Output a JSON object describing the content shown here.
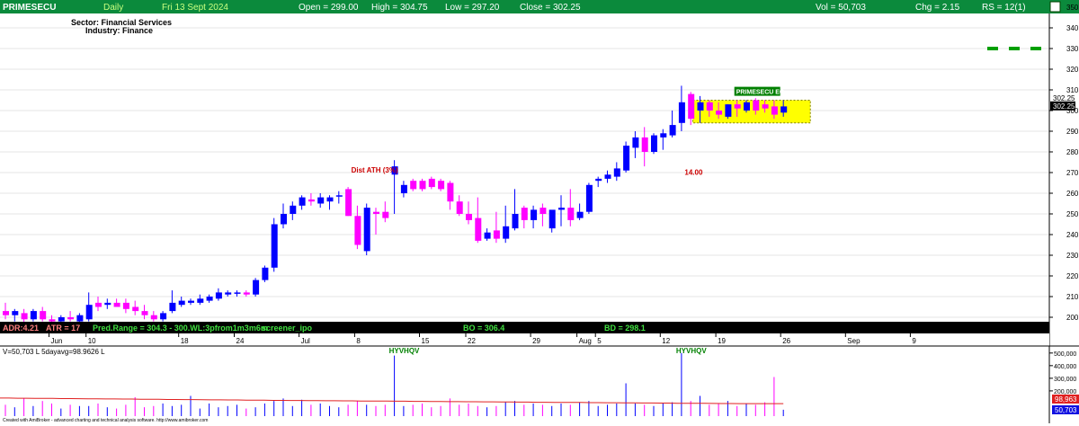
{
  "header": {
    "symbol": "PRIMESECU",
    "interval": "Daily",
    "date": "Fri 13 Sept 2024",
    "open": "Open = 299.00",
    "high": "High = 304.75",
    "low": "Low = 297.20",
    "close": "Close = 302.25",
    "volume": "Vol = 50,703",
    "change": "Chg = 2.15",
    "rs": "RS = 12(1)"
  },
  "info": {
    "sector": "Sector: Financial Services",
    "industry": "Industry: Finance"
  },
  "status_bar": {
    "adr": "ADR:4.21",
    "atr": "ATR = 17",
    "pred_range": "Pred.Range = 304.3 - 300.WL:3pfrom1m3m6m",
    "screener": "screener_ipo",
    "bo": "BO = 306.4",
    "bd": "BD = 298.1"
  },
  "volume_panel": {
    "label": "V=50,703 L 5dayavg=98.9626 L",
    "avg_value_label": "98,963",
    "last_value_label": "50,703",
    "y_ticks": [
      "500,000",
      "400,000",
      "300,000",
      "200,000"
    ],
    "ymax": 520000,
    "avg_line": [
      143000,
      143000,
      142000,
      142000,
      141000,
      140000,
      140000,
      139000,
      139000,
      138000,
      137000,
      137000,
      136000,
      136000,
      135000,
      135000,
      134000,
      134000,
      133000,
      132000,
      132000,
      131000,
      131000,
      130000,
      129000,
      129000,
      128000,
      128000,
      127000,
      126000,
      126000,
      125000,
      125000,
      124000,
      124000,
      123000,
      123000,
      122000,
      122000,
      121000,
      121000,
      120000,
      120000,
      119000,
      119000,
      118000,
      118000,
      117000,
      117000,
      116000,
      116000,
      115000,
      115000,
      114000,
      114000,
      113000,
      113000,
      112000,
      112000,
      111000,
      111000,
      110000,
      110000,
      109000,
      109000,
      108000,
      108000,
      107000,
      107000,
      106000,
      106000,
      105000,
      105000,
      104000,
      104000,
      103000,
      103000,
      102000,
      102000,
      101000,
      101000,
      100500,
      100000,
      99500,
      99000,
      99000,
      99000,
      99000,
      99000,
      99000
    ]
  },
  "footer": "Created with AmiBroker - advanced charting and technical analysis software. http://www.amibroker.com",
  "chart_data": {
    "type": "candlestick",
    "title": "PRIMESECU",
    "ylim": [
      195,
      355
    ],
    "y_ticks": [
      200,
      210,
      220,
      230,
      240,
      250,
      260,
      270,
      280,
      290,
      300,
      310,
      320,
      330,
      340,
      350
    ],
    "x_ticks": [
      {
        "i": 5,
        "label": "Jun"
      },
      {
        "i": 9,
        "label": "10"
      },
      {
        "i": 19,
        "label": "18"
      },
      {
        "i": 25,
        "label": "24"
      },
      {
        "i": 32,
        "label": "Jul"
      },
      {
        "i": 38,
        "label": "8"
      },
      {
        "i": 45,
        "label": "15"
      },
      {
        "i": 50,
        "label": "22"
      },
      {
        "i": 57,
        "label": "29"
      },
      {
        "i": 62,
        "label": "Aug"
      },
      {
        "i": 64,
        "label": "5"
      },
      {
        "i": 71,
        "label": "12"
      },
      {
        "i": 77,
        "label": "19"
      },
      {
        "i": 84,
        "label": "26"
      },
      {
        "i": 91,
        "label": "Sep"
      },
      {
        "i": 98,
        "label": "9"
      }
    ],
    "candles": [
      {
        "o": 203,
        "h": 207,
        "l": 199,
        "c": 201
      },
      {
        "o": 201,
        "h": 204,
        "l": 198,
        "c": 203
      },
      {
        "o": 202,
        "h": 204,
        "l": 197,
        "c": 199
      },
      {
        "o": 199,
        "h": 204,
        "l": 198,
        "c": 203
      },
      {
        "o": 203,
        "h": 205,
        "l": 198,
        "c": 199
      },
      {
        "o": 199,
        "h": 201,
        "l": 197,
        "c": 198
      },
      {
        "o": 198,
        "h": 201,
        "l": 196,
        "c": 200
      },
      {
        "o": 200,
        "h": 203,
        "l": 198,
        "c": 199
      },
      {
        "o": 198,
        "h": 202,
        "l": 197,
        "c": 201
      },
      {
        "o": 199,
        "h": 212,
        "l": 198,
        "c": 206
      },
      {
        "o": 207,
        "h": 210,
        "l": 203,
        "c": 205
      },
      {
        "o": 206,
        "h": 209,
        "l": 204,
        "c": 207
      },
      {
        "o": 207,
        "h": 209,
        "l": 205,
        "c": 205
      },
      {
        "o": 207,
        "h": 209,
        "l": 202,
        "c": 204
      },
      {
        "o": 205,
        "h": 208,
        "l": 201,
        "c": 203
      },
      {
        "o": 203,
        "h": 206,
        "l": 199,
        "c": 201
      },
      {
        "o": 201,
        "h": 203,
        "l": 198,
        "c": 199
      },
      {
        "o": 199,
        "h": 203,
        "l": 198,
        "c": 202
      },
      {
        "o": 203,
        "h": 213,
        "l": 202,
        "c": 207
      },
      {
        "o": 206,
        "h": 210,
        "l": 205,
        "c": 208
      },
      {
        "o": 207,
        "h": 209,
        "l": 206,
        "c": 208
      },
      {
        "o": 207,
        "h": 211,
        "l": 206,
        "c": 209
      },
      {
        "o": 208,
        "h": 211,
        "l": 207,
        "c": 210
      },
      {
        "o": 209,
        "h": 214,
        "l": 208,
        "c": 212
      },
      {
        "o": 211,
        "h": 213,
        "l": 210,
        "c": 212
      },
      {
        "o": 212,
        "h": 213,
        "l": 210,
        "c": 212
      },
      {
        "o": 212,
        "h": 213,
        "l": 210,
        "c": 211
      },
      {
        "o": 211,
        "h": 219,
        "l": 210,
        "c": 218
      },
      {
        "o": 218,
        "h": 225,
        "l": 217,
        "c": 224
      },
      {
        "o": 224,
        "h": 248,
        "l": 222,
        "c": 245
      },
      {
        "o": 245,
        "h": 255,
        "l": 243,
        "c": 250
      },
      {
        "o": 250,
        "h": 256,
        "l": 247,
        "c": 254
      },
      {
        "o": 254,
        "h": 259,
        "l": 252,
        "c": 258
      },
      {
        "o": 257,
        "h": 260,
        "l": 254,
        "c": 256
      },
      {
        "o": 255,
        "h": 260,
        "l": 253,
        "c": 258
      },
      {
        "o": 256,
        "h": 259,
        "l": 252,
        "c": 258
      },
      {
        "o": 259,
        "h": 261,
        "l": 255,
        "c": 259
      },
      {
        "o": 262,
        "h": 263,
        "l": 249,
        "c": 249
      },
      {
        "o": 249,
        "h": 254,
        "l": 233,
        "c": 235
      },
      {
        "o": 232,
        "h": 255,
        "l": 230,
        "c": 253
      },
      {
        "o": 251,
        "h": 253,
        "l": 240,
        "c": 250
      },
      {
        "o": 251,
        "h": 256,
        "l": 246,
        "c": 248
      },
      {
        "o": 269,
        "h": 276,
        "l": 250,
        "c": 273
      },
      {
        "o": 260,
        "h": 266,
        "l": 258,
        "c": 264
      },
      {
        "o": 266,
        "h": 267,
        "l": 261,
        "c": 262
      },
      {
        "o": 266,
        "h": 267,
        "l": 261,
        "c": 262
      },
      {
        "o": 267,
        "h": 268,
        "l": 262,
        "c": 263
      },
      {
        "o": 266,
        "h": 267,
        "l": 261,
        "c": 262
      },
      {
        "o": 265,
        "h": 266,
        "l": 252,
        "c": 256
      },
      {
        "o": 256,
        "h": 259,
        "l": 249,
        "c": 250
      },
      {
        "o": 250,
        "h": 256,
        "l": 245,
        "c": 247
      },
      {
        "o": 248,
        "h": 258,
        "l": 236,
        "c": 237
      },
      {
        "o": 238,
        "h": 243,
        "l": 237,
        "c": 241
      },
      {
        "o": 242,
        "h": 251,
        "l": 236,
        "c": 238
      },
      {
        "o": 238,
        "h": 254,
        "l": 236,
        "c": 244
      },
      {
        "o": 243,
        "h": 262,
        "l": 242,
        "c": 250
      },
      {
        "o": 253,
        "h": 254,
        "l": 243,
        "c": 247
      },
      {
        "o": 247,
        "h": 254,
        "l": 243,
        "c": 252
      },
      {
        "o": 253,
        "h": 255,
        "l": 244,
        "c": 250
      },
      {
        "o": 243,
        "h": 248,
        "l": 241,
        "c": 252
      },
      {
        "o": 252,
        "h": 259,
        "l": 244,
        "c": 253
      },
      {
        "o": 253,
        "h": 262,
        "l": 244,
        "c": 247
      },
      {
        "o": 248,
        "h": 255,
        "l": 247,
        "c": 251
      },
      {
        "o": 251,
        "h": 265,
        "l": 250,
        "c": 264
      },
      {
        "o": 266,
        "h": 268,
        "l": 263,
        "c": 267
      },
      {
        "o": 267,
        "h": 271,
        "l": 265,
        "c": 269
      },
      {
        "o": 268,
        "h": 275,
        "l": 266,
        "c": 272
      },
      {
        "o": 271,
        "h": 285,
        "l": 270,
        "c": 283
      },
      {
        "o": 282,
        "h": 290,
        "l": 277,
        "c": 287
      },
      {
        "o": 287,
        "h": 292,
        "l": 273,
        "c": 280
      },
      {
        "o": 280,
        "h": 289,
        "l": 279,
        "c": 288
      },
      {
        "o": 287,
        "h": 291,
        "l": 281,
        "c": 289
      },
      {
        "o": 288,
        "h": 300,
        "l": 287,
        "c": 293
      },
      {
        "o": 294,
        "h": 312,
        "l": 290,
        "c": 304
      },
      {
        "o": 308,
        "h": 309,
        "l": 293,
        "c": 296
      },
      {
        "o": 300,
        "h": 307,
        "l": 294,
        "c": 304
      },
      {
        "o": 304,
        "h": 305,
        "l": 297,
        "c": 300
      },
      {
        "o": 300,
        "h": 304,
        "l": 296,
        "c": 298
      },
      {
        "o": 297,
        "h": 303,
        "l": 296,
        "c": 303
      },
      {
        "o": 303,
        "h": 305,
        "l": 297,
        "c": 301
      },
      {
        "o": 300,
        "h": 305,
        "l": 299,
        "c": 304
      },
      {
        "o": 305,
        "h": 306,
        "l": 298,
        "c": 300
      },
      {
        "o": 303,
        "h": 305,
        "l": 299,
        "c": 301
      },
      {
        "o": 302,
        "h": 305,
        "l": 296,
        "c": 298
      },
      {
        "o": 299,
        "h": 305,
        "l": 297,
        "c": 302
      }
    ],
    "volumes": [
      90000,
      70000,
      140000,
      80000,
      120000,
      100000,
      60000,
      90000,
      80000,
      80000,
      100000,
      70000,
      60000,
      90000,
      150000,
      70000,
      80000,
      100000,
      80000,
      90000,
      160000,
      60000,
      100000,
      70000,
      80000,
      90000,
      60000,
      70000,
      100000,
      120000,
      140000,
      80000,
      130000,
      90000,
      100000,
      80000,
      70000,
      90000,
      120000,
      90000,
      80000,
      90000,
      480000,
      80000,
      90000,
      100000,
      70000,
      80000,
      140000,
      90000,
      100000,
      80000,
      70000,
      80000,
      110000,
      120000,
      90000,
      100000,
      90000,
      80000,
      100000,
      90000,
      110000,
      120000,
      80000,
      90000,
      100000,
      260000,
      100000,
      90000,
      80000,
      100000,
      110000,
      500000,
      120000,
      160000,
      90000,
      100000,
      120000,
      80000,
      100000,
      90000,
      110000,
      310000,
      50703
    ],
    "annotations": [
      {
        "text": "Dist ATH (3%)",
        "i": 42,
        "y": 270,
        "color": "#cc0000"
      },
      {
        "text": "HYVHQV",
        "i": 42,
        "panel": "volume",
        "color": "#008000"
      },
      {
        "text": "HYVHQV",
        "i": 73,
        "panel": "volume",
        "color": "#008000"
      },
      {
        "text": "14.00",
        "i": 78,
        "y": 269,
        "color": "#cc0000"
      },
      {
        "text": "PRIMESECU EQ",
        "i": 79,
        "y": 308,
        "color": "#ffffff",
        "bg": "#008000"
      }
    ],
    "consolidation_box": {
      "i0": 75,
      "i1": 84,
      "y0": 294,
      "y1": 305,
      "fill": "#ffff00"
    },
    "resistance_line": {
      "y": 330,
      "color": "#00a000"
    },
    "price_label": "302.25",
    "colors": {
      "up": "#0000ff",
      "down": "#ff00ff"
    }
  }
}
